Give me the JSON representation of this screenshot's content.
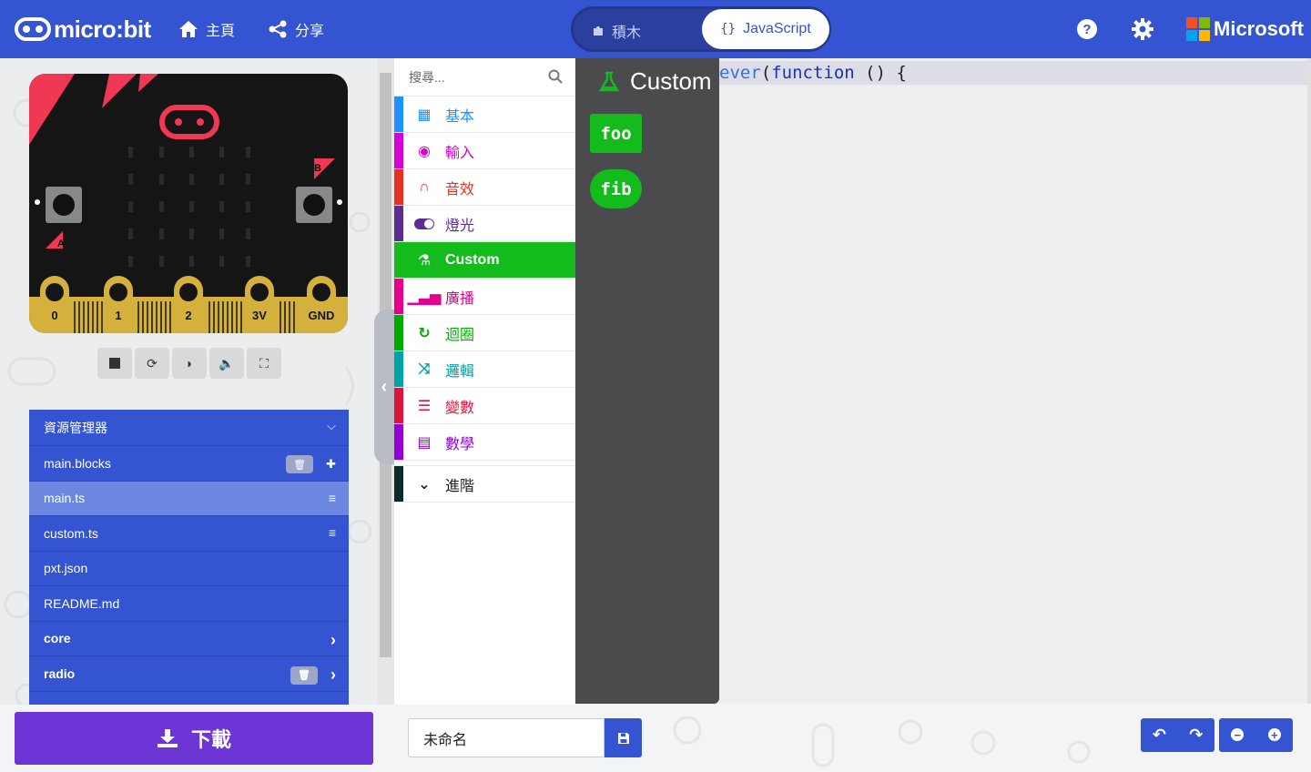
{
  "header": {
    "logo_text": "micro:bit",
    "home_label": "主頁",
    "share_label": "分享",
    "blocks_label": "積木",
    "js_label": "JavaScript",
    "ms_label": "Microsoft",
    "help_icon": "help-icon",
    "settings_icon": "gear-icon"
  },
  "simulator": {
    "pins": [
      "0",
      "1",
      "2",
      "3V",
      "GND"
    ],
    "button_a": "A",
    "button_b": "B",
    "controls": [
      "stop-icon",
      "restart-icon",
      "slowmo-icon",
      "sound-icon",
      "fullscreen-icon"
    ]
  },
  "explorer": {
    "title": "資源管理器",
    "files": [
      {
        "name": "main.blocks"
      },
      {
        "name": "main.ts"
      },
      {
        "name": "custom.ts"
      },
      {
        "name": "pxt.json"
      },
      {
        "name": "README.md"
      },
      {
        "name": "core"
      },
      {
        "name": "radio"
      }
    ]
  },
  "toolbox": {
    "search_placeholder": "搜尋...",
    "categories": [
      {
        "label": "基本",
        "color": "#1e90ff"
      },
      {
        "label": "輸入",
        "color": "#d400d4"
      },
      {
        "label": "音效",
        "color": "#e63022"
      },
      {
        "label": "燈光",
        "color": "#5c2d91"
      },
      {
        "label": "Custom",
        "color": "#13bb1d"
      },
      {
        "label": "廣播",
        "color": "#e3008c"
      },
      {
        "label": "迴圈",
        "color": "#00aa00"
      },
      {
        "label": "邏輯",
        "color": "#00a4a6"
      },
      {
        "label": "變數",
        "color": "#dc143c"
      },
      {
        "label": "數學",
        "color": "#9400d3"
      },
      {
        "label": "進階",
        "color": "#3c3c3c"
      }
    ]
  },
  "flyout": {
    "title": "Custom",
    "blocks": [
      "foo",
      "fib"
    ]
  },
  "editor": {
    "code_line_1_a": "ever",
    "code_line_1_b": "(",
    "code_line_1_c": "function",
    "code_line_1_d": " () {"
  },
  "bottom": {
    "download_label": "下載",
    "project_name": "未命名"
  }
}
